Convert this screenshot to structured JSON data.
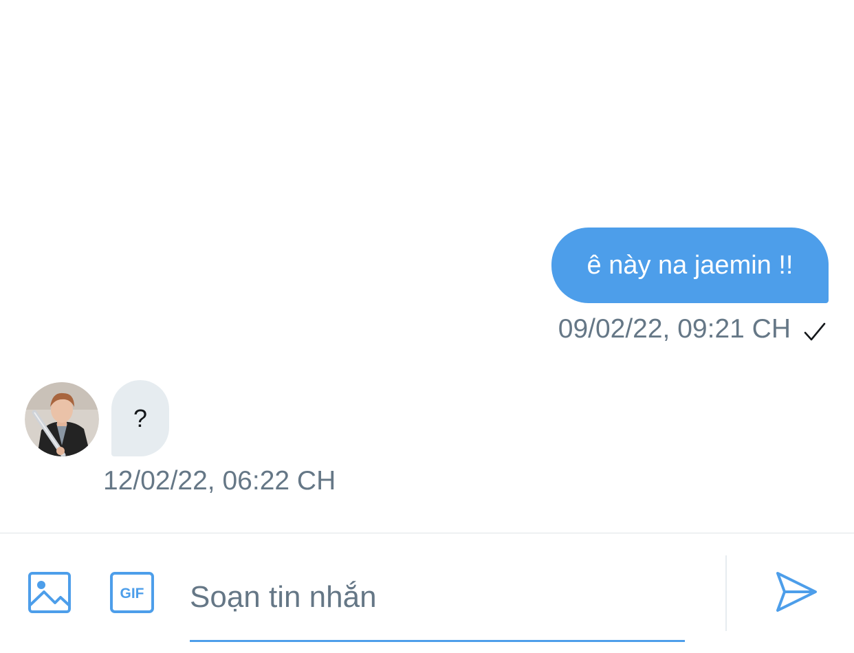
{
  "conversation": {
    "messages": [
      {
        "direction": "sent",
        "text": "ê này na jaemin !!",
        "timestamp": "09/02/22, 09:21 CH",
        "status_icon": "check-icon"
      },
      {
        "direction": "received",
        "text": "?",
        "timestamp": "12/02/22, 06:22 CH",
        "avatar_icon": "avatar"
      }
    ]
  },
  "composer": {
    "placeholder": "Soạn tin nhắn",
    "value": "",
    "media_icon": "image-icon",
    "gif_icon": "gif-icon",
    "gif_label": "GIF",
    "send_icon": "send-icon"
  },
  "colors": {
    "accent": "#4d9eea",
    "received_bubble": "#e6ecf0",
    "meta_text": "#657786"
  }
}
